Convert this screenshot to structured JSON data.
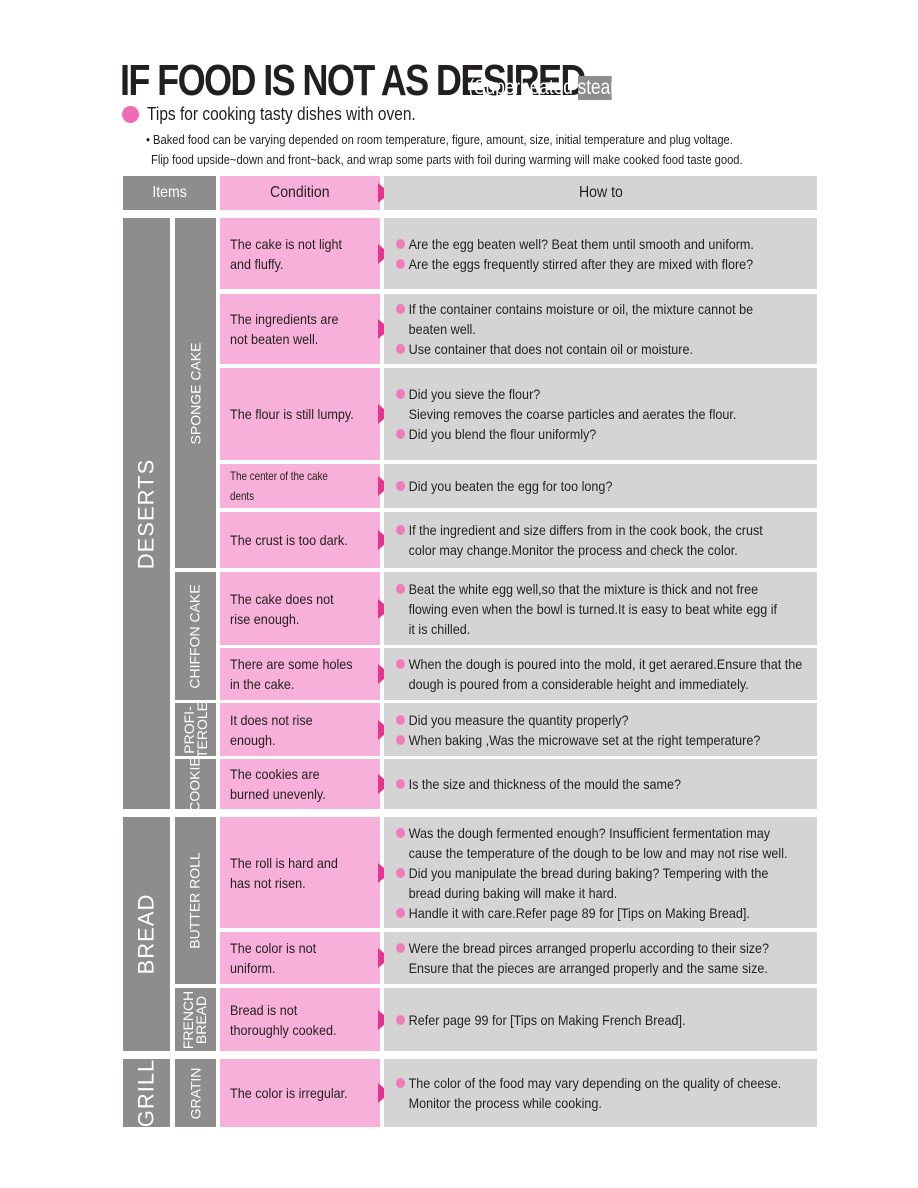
{
  "header": {
    "title": "IF FOOD IS NOT AS DESIRED",
    "subtitle": "(Superheated steam,Convection)",
    "tips_heading": "Tips for cooking tasty dishes with oven.",
    "note_line1": "• Baked food can be varying depended on room temperature, figure, amount, size, initial temperature and plug voltage.",
    "note_line2": "Flip food upside~down and front~back, and wrap some parts with foil during warming will make cooked food taste good."
  },
  "table": {
    "columns": {
      "items": "Items",
      "condition": "Condition",
      "how_to": "How to"
    },
    "categories": [
      {
        "label": "DESERTS"
      },
      {
        "label": "BREAD"
      },
      {
        "label": "GRILL"
      }
    ],
    "subcategories": [
      {
        "label": "SPONGE CAKE"
      },
      {
        "label": "CHIFFON CAKE"
      },
      {
        "label": "PROFI-\nTEROLE"
      },
      {
        "label": "COOKIE"
      },
      {
        "label": "BUTTER ROLL"
      },
      {
        "label": "FRENCH\nBREAD"
      },
      {
        "label": "GRATIN"
      }
    ],
    "rows": [
      {
        "condition": "The cake is not light and fluffy.",
        "how_to": [
          {
            "bullet": true,
            "text": "Are the egg beaten well? Beat them until smooth and uniform."
          },
          {
            "bullet": true,
            "text": "Are the eggs frequently stirred after  they are mixed with flore?"
          }
        ]
      },
      {
        "condition": "The ingredients are not beaten well.",
        "how_to": [
          {
            "bullet": true,
            "text": "If the container contains moisture or oil, the mixture cannot be"
          },
          {
            "bullet": false,
            "text": "beaten well."
          },
          {
            "bullet": true,
            "text": "Use container that does not contain oil or moisture."
          }
        ]
      },
      {
        "condition": "The flour is still lumpy.",
        "how_to": [
          {
            "bullet": true,
            "text": "Did you sieve the flour?"
          },
          {
            "bullet": false,
            "text": "Sieving removes the coarse particles and aerates the flour."
          },
          {
            "bullet": true,
            "text": "Did you blend the flour uniformly?"
          }
        ]
      },
      {
        "condition": "The center of the cake dents",
        "how_to": [
          {
            "bullet": true,
            "text": "Did you beaten the egg for too long?"
          }
        ]
      },
      {
        "condition": "The crust is too dark.",
        "how_to": [
          {
            "bullet": true,
            "text": "If the ingredient and size differs from in the cook book, the crust"
          },
          {
            "bullet": false,
            "text": "color may change.Monitor the process and check the color."
          }
        ]
      },
      {
        "condition": "The cake does not rise enough.",
        "how_to": [
          {
            "bullet": true,
            "text": "Beat the white egg well,so that the mixture is thick and not free"
          },
          {
            "bullet": false,
            "text": "flowing even when the bowl is turned.It is easy to beat white egg if"
          },
          {
            "bullet": false,
            "text": "it is chilled."
          }
        ]
      },
      {
        "condition": "There are some holes in the cake.",
        "how_to": [
          {
            "bullet": true,
            "text": "When the dough is poured into the mold, it get aerared.Ensure that the"
          },
          {
            "bullet": false,
            "text": "dough is poured from a considerable height and immediately."
          }
        ]
      },
      {
        "condition": "It does not rise enough.",
        "how_to": [
          {
            "bullet": true,
            "text": "Did you measure the quantity properly?"
          },
          {
            "bullet": true,
            "text": "When baking ,Was the microwave set at the right temperature?"
          }
        ]
      },
      {
        "condition": "The cookies are burned unevenly.",
        "how_to": [
          {
            "bullet": true,
            "text": "Is the size and thickness of the mould the same?"
          }
        ]
      },
      {
        "condition": "The roll is hard and has not risen.",
        "how_to": [
          {
            "bullet": true,
            "text": "Was the dough fermented enough? Insufficient fermentation may"
          },
          {
            "bullet": false,
            "text": "cause the temperature of the dough to be low and may not rise well."
          },
          {
            "bullet": true,
            "text": "Did you manipulate the bread during baking? Tempering with the"
          },
          {
            "bullet": false,
            "text": "bread during baking will make it hard."
          },
          {
            "bullet": true,
            "text": "Handle it with care.Refer page 89 for [Tips on Making Bread]."
          }
        ]
      },
      {
        "condition": "The color is not uniform.",
        "how_to": [
          {
            "bullet": true,
            "text": "Were the bread pirces arranged properlu according to their size?"
          },
          {
            "bullet": false,
            "text": "Ensure that the pieces are arranged properly and the same size."
          }
        ]
      },
      {
        "condition": "Bread is not thoroughly cooked.",
        "how_to": [
          {
            "bullet": true,
            "text": "Refer page 99 for [Tips on Making French Bread]."
          }
        ]
      },
      {
        "condition": "The color is irregular.",
        "how_to": [
          {
            "bullet": true,
            "text": "The color of the food may vary depending on the quality of cheese."
          },
          {
            "bullet": false,
            "text": "Monitor the process while cooking."
          }
        ]
      }
    ]
  },
  "colors": {
    "category_gray": "#8e8c8d",
    "condition_pink": "#f7b0d9",
    "howto_gray": "#d5d4d4",
    "arrow_magenta": "#e5338f",
    "bullet_pink": "#f07bba"
  }
}
